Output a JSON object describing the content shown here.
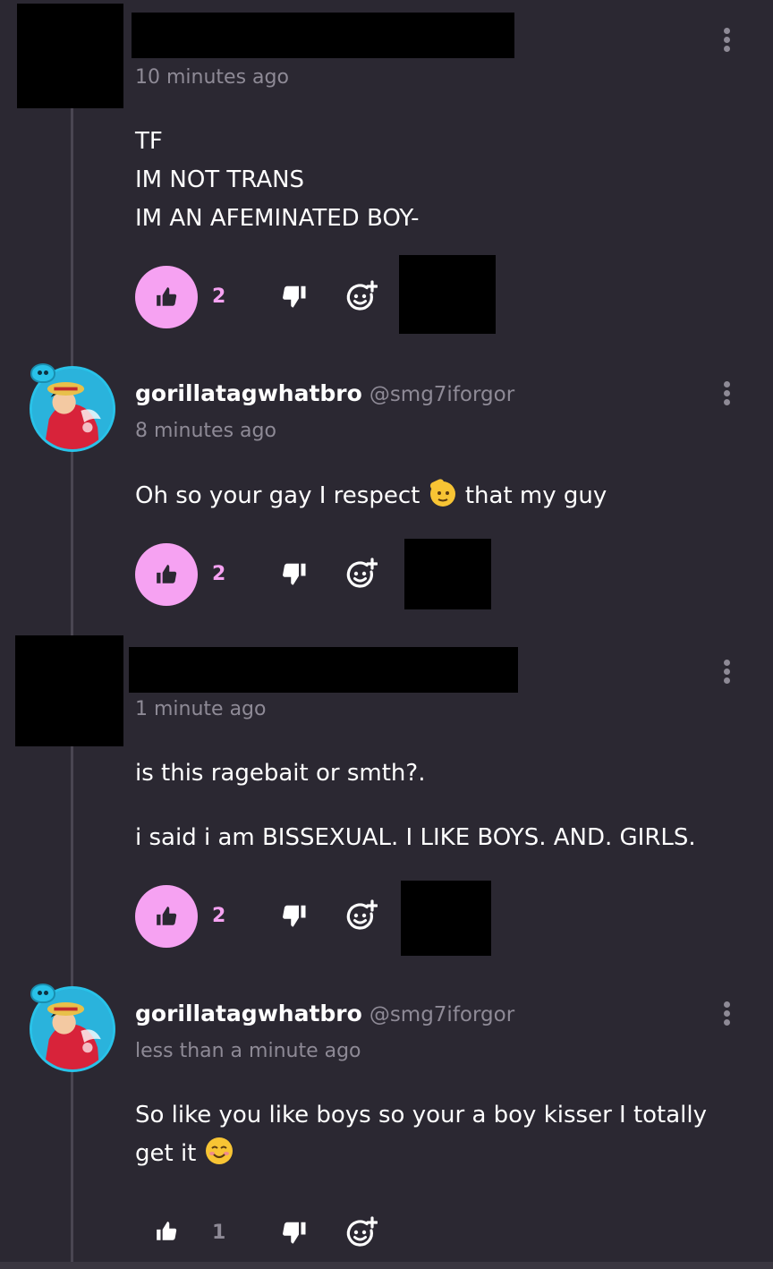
{
  "comments": [
    {
      "time": "10 minutes ago",
      "text": "TF\nIM NOT TRANS\nIM AN AFEMINATED BOY-",
      "likes": "2"
    },
    {
      "username": "gorillatagwhatbro",
      "handle": "@smg7iforgor",
      "time": "8 minutes ago",
      "text_before": "Oh so your gay I respect ",
      "emoji": "saluting-face",
      "text_after": " that my guy",
      "likes": "2"
    },
    {
      "time": "1 minute ago",
      "line1": "is this ragebait or smth?.",
      "line2": "i said i am BISSEXUAL. I LIKE BOYS. AND. GIRLS.",
      "likes": "2"
    },
    {
      "username": "gorillatagwhatbro",
      "handle": "@smg7iforgor",
      "time": "less than a minute ago",
      "line1": "So like you like boys so your a boy kisser I totally",
      "line2": "get it ",
      "emoji": "smiling-face",
      "likes": "1"
    }
  ],
  "icons": {
    "like": "thumbs-up-icon",
    "dislike": "thumbs-down-icon",
    "react": "add-reaction-icon",
    "menu": "more-vertical-icon"
  },
  "colors": {
    "background": "#2b2832",
    "accent_pink": "#f6a2f2",
    "muted": "#8e8a96"
  }
}
